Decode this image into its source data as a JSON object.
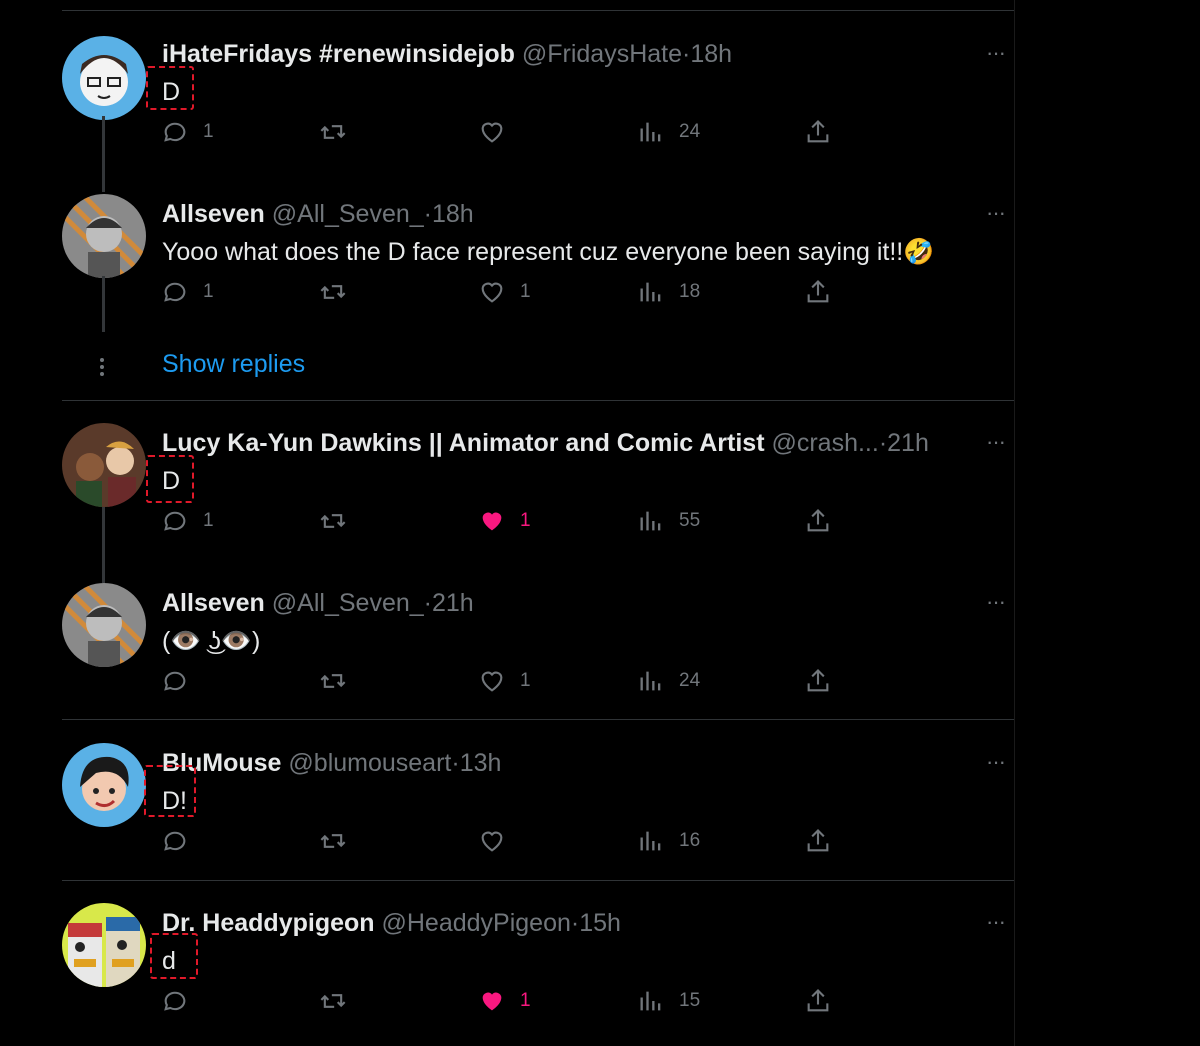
{
  "tweets": [
    {
      "name": "iHateFridays #renewinsidejob",
      "handle": "@FridaysHate",
      "dot": "·",
      "time": "18h",
      "text": "D",
      "replies": "1",
      "retweets": "",
      "likes": "",
      "views": "24",
      "liked": false
    },
    {
      "name": "Allseven",
      "handle": "@All_Seven_",
      "dot": "·",
      "time": "18h",
      "text": "Yooo what does the D face represent cuz everyone been saying it!!🤣",
      "replies": "1",
      "retweets": "",
      "likes": "1",
      "views": "18",
      "liked": false
    },
    {
      "name": "Lucy Ka-Yun Dawkins || Animator and Comic Artist",
      "handle": "@crash...",
      "dot": "·",
      "time": "21h",
      "text": "D",
      "replies": "1",
      "retweets": "",
      "likes": "1",
      "views": "55",
      "liked": true
    },
    {
      "name": "Allseven",
      "handle": "@All_Seven_",
      "dot": "·",
      "time": "21h",
      "text": "(👁️ ͜ʖ👁️)",
      "replies": "",
      "retweets": "",
      "likes": "1",
      "views": "24",
      "liked": false
    },
    {
      "name": "BluMouse",
      "handle": "@blumouseart",
      "dot": "·",
      "time": "13h",
      "text": "D!",
      "replies": "",
      "retweets": "",
      "likes": "",
      "views": "16",
      "liked": false
    },
    {
      "name": "Dr. Headdypigeon",
      "handle": "@HeaddyPigeon",
      "dot": "·",
      "time": "15h",
      "text": "d",
      "replies": "",
      "retweets": "",
      "likes": "1",
      "views": "15",
      "liked": true
    }
  ],
  "show_replies_label": "Show replies",
  "more_label": "···",
  "colors": {
    "background": "#000000",
    "text": "#e7e9ea",
    "muted": "#71767b",
    "link": "#1d9bf0",
    "like": "#f91880",
    "highlight_box": "#e0192a"
  },
  "icons": [
    "reply-icon",
    "retweet-icon",
    "like-icon",
    "views-icon",
    "share-icon",
    "more-icon"
  ]
}
